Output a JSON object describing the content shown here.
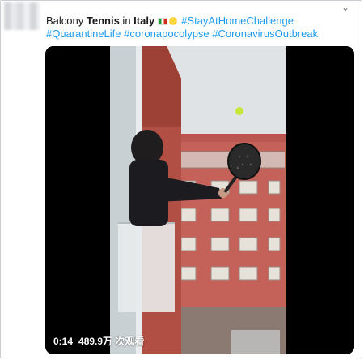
{
  "tweet": {
    "title_pre": "Balcony ",
    "title_bold": "Tennis",
    "title_mid": " in ",
    "title_bold2": "Italy",
    "hashtag1": "#StayAtHomeChallenge",
    "hashtags_line2": [
      "#QuarantineLife",
      "#coronapocolypse",
      "#CoronavirusOutbreak"
    ]
  },
  "video": {
    "duration": "0:14",
    "views": "489.9万 次观看"
  },
  "colors": {
    "link": "#1d9bf0",
    "brick": "#c4625a",
    "sky": "#dfe3e6"
  },
  "icons": {
    "flag": "italy-flag-icon",
    "sun": "sun-icon",
    "menu": "chevron-down-icon"
  }
}
